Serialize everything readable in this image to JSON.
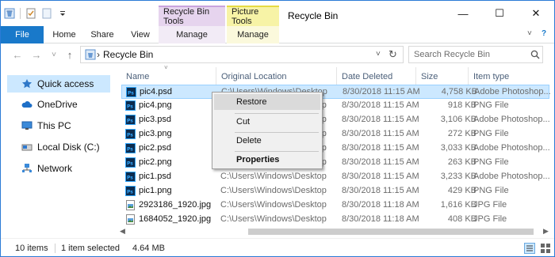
{
  "colors": {
    "accent": "#1979ca",
    "selection": "#cce8ff",
    "recycle_tools": "#e6d4ee",
    "picture_tools": "#f7f3a6"
  },
  "titlebar": {
    "title": "Recycle Bin",
    "contextual_tabs": [
      "Recycle Bin Tools",
      "Picture Tools"
    ],
    "controls": {
      "minimize": "—",
      "maximize": "☐",
      "close": "✕"
    }
  },
  "ribbon": {
    "tabs": [
      "File",
      "Home",
      "Share",
      "View",
      "Manage",
      "Manage"
    ],
    "collapse": "˅",
    "help": "?"
  },
  "address": {
    "back": "←",
    "forward": "→",
    "recent": "˅",
    "up": "↑",
    "path_sep": "›",
    "path": "Recycle Bin",
    "dropdown": "˅",
    "refresh": "↻",
    "search_placeholder": "Search Recycle Bin"
  },
  "nav": {
    "items": [
      "Quick access",
      "OneDrive",
      "This PC",
      "Local Disk (C:)",
      "Network"
    ]
  },
  "columns": {
    "sort_glyph": "˅",
    "headers": [
      "Name",
      "Original Location",
      "Date Deleted",
      "Size",
      "Item type"
    ]
  },
  "files": [
    {
      "name": "pic4.psd",
      "location": "C:\\Users\\Windows\\Desktop",
      "date": "8/30/2018 11:15 AM",
      "size": "4,758 KB",
      "type": "Adobe Photoshop...",
      "icon": "psd-file-icon"
    },
    {
      "name": "pic4.png",
      "location": "C:\\Users\\Windows\\Desktop",
      "date": "8/30/2018 11:15 AM",
      "size": "918 KB",
      "type": "PNG File",
      "icon": "png-file-icon"
    },
    {
      "name": "pic3.psd",
      "location": "C:\\Users\\Windows\\Desktop",
      "date": "8/30/2018 11:15 AM",
      "size": "3,106 KB",
      "type": "Adobe Photoshop...",
      "icon": "psd-file-icon"
    },
    {
      "name": "pic3.png",
      "location": "C:\\Users\\Windows\\Desktop",
      "date": "8/30/2018 11:15 AM",
      "size": "272 KB",
      "type": "PNG File",
      "icon": "png-file-icon"
    },
    {
      "name": "pic2.psd",
      "location": "C:\\Users\\Windows\\Desktop",
      "date": "8/30/2018 11:15 AM",
      "size": "3,033 KB",
      "type": "Adobe Photoshop...",
      "icon": "psd-file-icon"
    },
    {
      "name": "pic2.png",
      "location": "C:\\Users\\Windows\\Desktop",
      "date": "8/30/2018 11:15 AM",
      "size": "263 KB",
      "type": "PNG File",
      "icon": "png-file-icon"
    },
    {
      "name": "pic1.psd",
      "location": "C:\\Users\\Windows\\Desktop",
      "date": "8/30/2018 11:15 AM",
      "size": "3,233 KB",
      "type": "Adobe Photoshop...",
      "icon": "psd-file-icon"
    },
    {
      "name": "pic1.png",
      "location": "C:\\Users\\Windows\\Desktop",
      "date": "8/30/2018 11:15 AM",
      "size": "429 KB",
      "type": "PNG File",
      "icon": "png-file-icon"
    },
    {
      "name": "2923186_1920.jpg",
      "location": "C:\\Users\\Windows\\Desktop",
      "date": "8/30/2018 11:18 AM",
      "size": "1,616 KB",
      "type": "JPG File",
      "icon": "jpg-file-icon"
    },
    {
      "name": "1684052_1920.jpg",
      "location": "C:\\Users\\Windows\\Desktop",
      "date": "8/30/2018 11:18 AM",
      "size": "408 KB",
      "type": "JPG File",
      "icon": "jpg-file-icon"
    }
  ],
  "selected_index": 0,
  "context_menu": {
    "items": [
      "Restore",
      "Cut",
      "Delete",
      "Properties"
    ]
  },
  "hscroll": {
    "left": "◀",
    "right": "▶"
  },
  "status": {
    "item_count": "10 items",
    "selection": "1 item selected",
    "size": "4.64 MB"
  }
}
